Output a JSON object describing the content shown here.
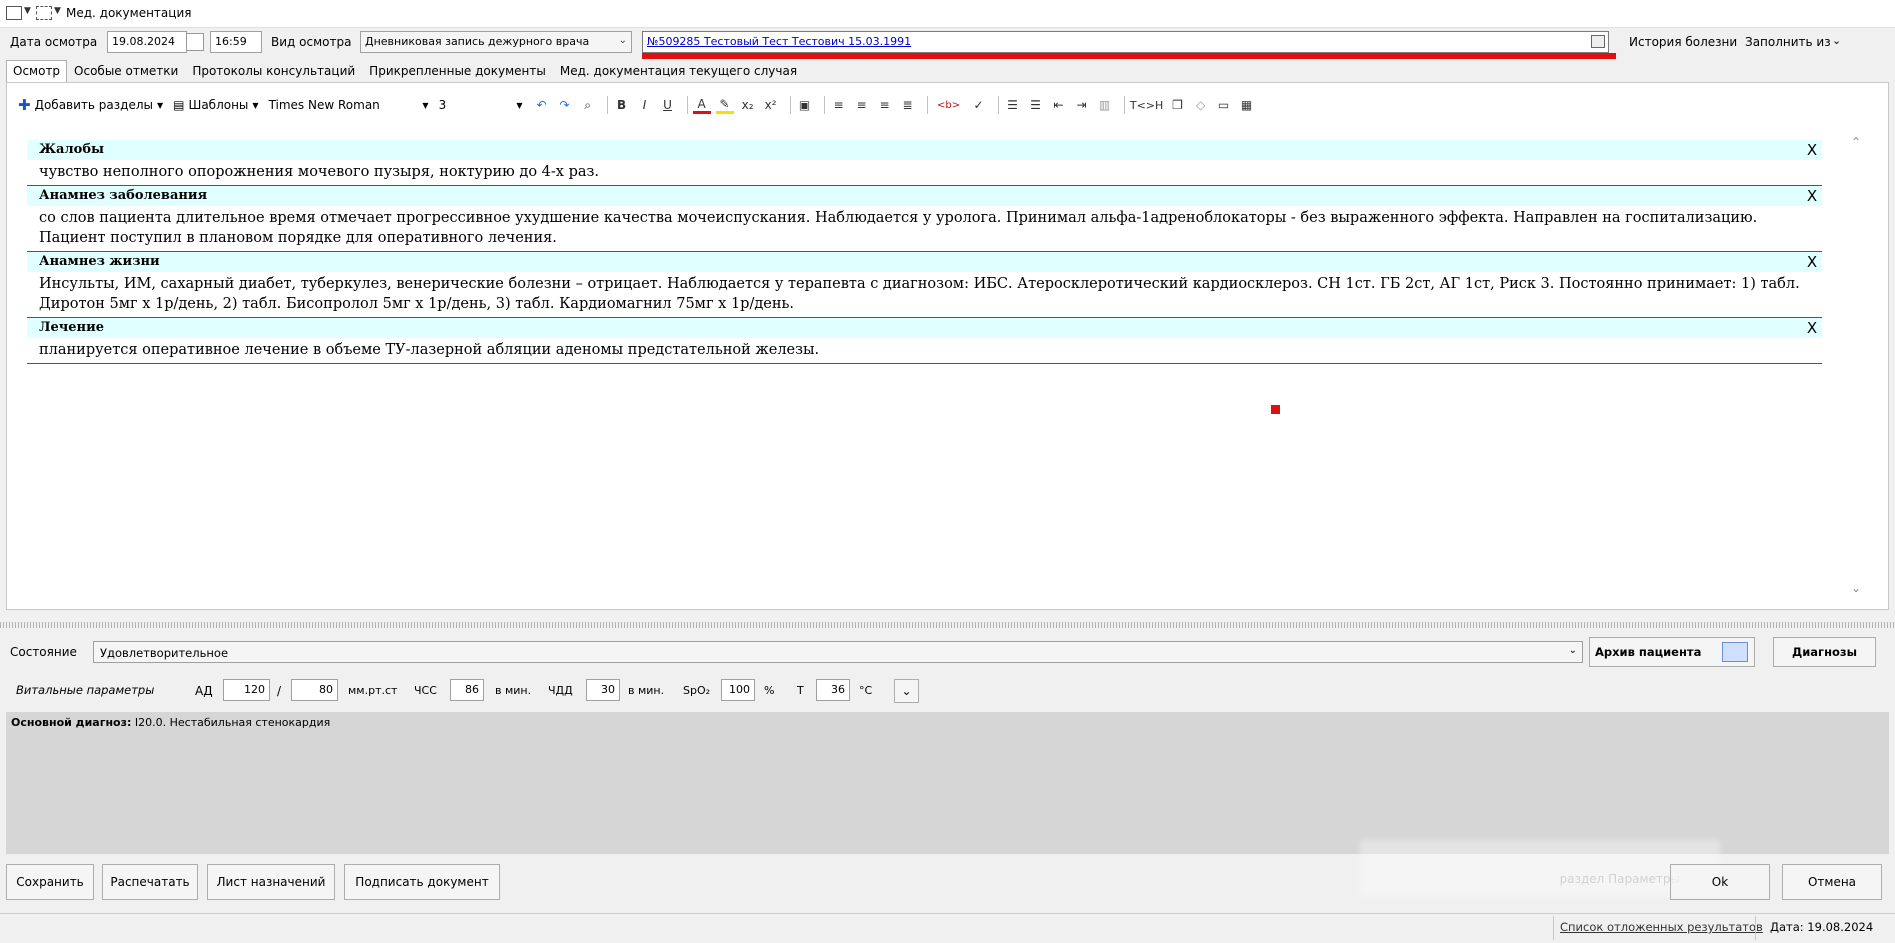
{
  "app": {
    "title": "Мед. документация"
  },
  "header": {
    "date_label": "Дата осмотра",
    "date_value": "19.08.2024",
    "time_value": "16:59",
    "exam_type_label": "Вид осмотра",
    "exam_type_value": "Дневниковая запись дежурного врача",
    "patient_link": "№509285 Тестовый Тест Тестович 15.03.1991",
    "history_label": "История болезни",
    "fill_from_label": "Заполнить из"
  },
  "tabs": [
    {
      "label": "Осмотр",
      "active": true
    },
    {
      "label": "Особые отметки"
    },
    {
      "label": "Протоколы консультаций"
    },
    {
      "label": "Прикрепленные документы"
    },
    {
      "label": "Мед. документация текущего случая"
    }
  ],
  "toolbar": {
    "add_sections": "Добавить разделы",
    "templates": "Шаблоны",
    "font_name": "Times New Roman",
    "font_size": "3",
    "replace_label": "T<>H"
  },
  "sections": [
    {
      "title": "Жалобы",
      "text": "чувство неполного опорожнения мочевого пузыря, ноктурию до 4-х раз."
    },
    {
      "title": "Анамнез заболевания",
      "text": "со слов пациента длительное время отмечает прогрессивное ухудшение качества мочеиспускания. Наблюдается у уролога. Принимал альфа-1адреноблокаторы - без выраженного эффекта. Направлен на госпитализацию. Пациент поступил в плановом порядке для оперативного лечения."
    },
    {
      "title": "Анамнез жизни",
      "text": "Инсульты, ИМ, сахарный диабет, туберкулез, венерические болезни – отрицает. Наблюдается у терапевта с диагнозом: ИБС. Атеросклеротический кардиосклероз. СН 1ст. ГБ 2ст, АГ 1ст, Риск 3. Постоянно принимает: 1) табл. Диротон 5мг х 1р/день, 2) табл. Бисопролол 5мг х 1р/день, 3) табл. Кардиомагнил 75мг х 1р/день."
    },
    {
      "title": "Лечение",
      "text": "планируется оперативное лечение в объеме ТУ-лазерной абляции аденомы предстательной железы."
    }
  ],
  "section_close": "X",
  "state": {
    "label": "Состояние",
    "value": "Удовлетворительное"
  },
  "buttons": {
    "archive": "Архив пациента",
    "diagnoses": "Диагнозы",
    "save": "Сохранить",
    "print": "Распечатать",
    "prescriptions": "Лист назначений",
    "sign": "Подписать документ",
    "ok": "Ok",
    "cancel": "Отмена"
  },
  "vitals": {
    "title": "Витальные параметры",
    "bp_label": "АД",
    "bp_sys": "120",
    "bp_sep": "/",
    "bp_dia": "80",
    "bp_unit": "мм.рт.ст",
    "hr_label": "ЧСС",
    "hr_value": "86",
    "hr_unit": "в мин.",
    "rr_label": "ЧДД",
    "rr_value": "30",
    "rr_unit": "в мин.",
    "spo2_label": "SpO₂",
    "spo2_value": "100",
    "spo2_unit": "%",
    "t_label": "Т",
    "t_value": "36",
    "t_unit": "°С"
  },
  "diagnosis": {
    "label": "Основной диагноз:",
    "value": "I20.0. Нестабильная стенокардия"
  },
  "ghost_text": "раздел Параметры",
  "statusbar": {
    "deferred": "Список отложенных результатов",
    "date": "Дата: 19.08.2024"
  },
  "colors": {
    "accent_red": "#dd1111",
    "section_bg": "#e0ffff",
    "link": "#0000cc"
  }
}
